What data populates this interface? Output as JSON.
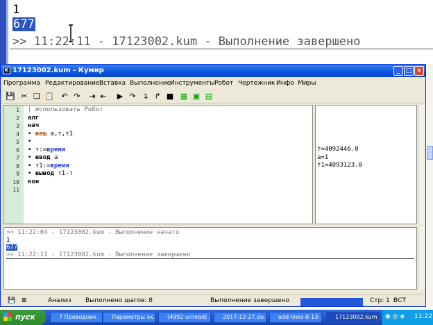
{
  "zoom": {
    "line1": "1",
    "line2": "677",
    "line3": ">> 11:22:11 - 17123002.kum - Выполнение завершено"
  },
  "window": {
    "title": "17123002.kum - Кумир",
    "icon": "K"
  },
  "menu": [
    "Программа",
    "Редактирование",
    "Вставка",
    "Выполнение",
    "Инструменты",
    "Робот",
    "Чертежник",
    "Инфо",
    "Миры"
  ],
  "toolbar": {
    "icons": [
      "save-icon",
      "cut-icon",
      "copy-icon",
      "paste-icon",
      "undo-icon",
      "redo-icon",
      "indent-icon",
      "unindent-icon",
      "run-icon",
      "step-icon",
      "step-into-icon",
      "step-out-icon",
      "stop-icon",
      "grid-icon",
      "robot-icon",
      "draw-icon"
    ]
  },
  "editor": {
    "line_numbers": [
      "1",
      "2",
      "3",
      "4",
      "5",
      "6",
      "7",
      "8",
      "9",
      "10",
      "11"
    ],
    "lines": [
      {
        "text": "| использовать Робот",
        "cls": "cm"
      },
      {
        "text": "алг",
        "cls": "kw"
      },
      {
        "text": "нач",
        "cls": "kw"
      },
      {
        "parts": [
          {
            "t": "• ",
            "c": ""
          },
          {
            "t": "вещ",
            "c": "tp"
          },
          {
            "t": " a,т,т1",
            "c": ""
          }
        ]
      },
      {
        "parts": [
          {
            "t": "•",
            "c": ""
          }
        ]
      },
      {
        "parts": [
          {
            "t": "• т:=",
            "c": ""
          },
          {
            "t": "время",
            "c": "fn"
          }
        ]
      },
      {
        "parts": [
          {
            "t": "• ",
            "c": ""
          },
          {
            "t": "ввод",
            "c": "kw"
          },
          {
            "t": " a",
            "c": ""
          }
        ]
      },
      {
        "parts": [
          {
            "t": "• т1:=",
            "c": ""
          },
          {
            "t": "время",
            "c": "fn"
          }
        ]
      },
      {
        "parts": [
          {
            "t": "• ",
            "c": ""
          },
          {
            "t": "вывод",
            "c": "kw"
          },
          {
            "t": " т1-т",
            "c": ""
          }
        ]
      },
      {
        "text": "кон",
        "cls": "kw"
      },
      {
        "text": "",
        "cls": ""
      }
    ]
  },
  "margin": [
    "т=4092446.0",
    "a=1",
    "т1=4093123.0"
  ],
  "output": {
    "lines": [
      ">> 11:22:04 - 17123002.kum - Выполнение начато",
      "1",
      "677",
      ">> 11:22:11 - 17123002.kum - Выполнение завершено"
    ]
  },
  "status": {
    "mode": "Анализ",
    "steps": "Выполнено шагов: 8",
    "state": "Выполнение завершено",
    "pos": "Стр: 1",
    "ins": "ВСТ"
  },
  "taskbar": {
    "start": "пуск",
    "items": [
      "7 Проводник",
      "Параметры эк...",
      "(4992 unread) ...",
      "2017-12-27.do...",
      "add-links-8-13-...",
      "17123002.kum ..."
    ],
    "clock": "11:22"
  }
}
